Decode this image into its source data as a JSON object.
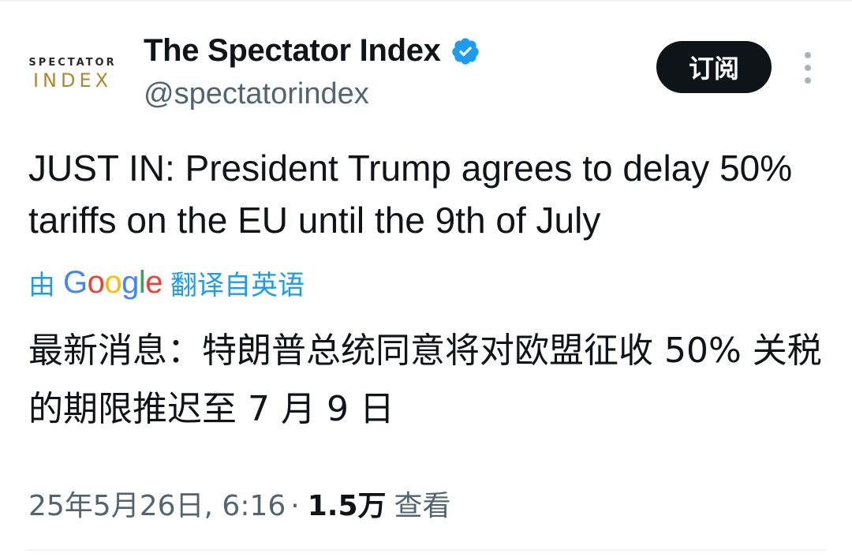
{
  "account": {
    "avatar_line1": "SPECTATOR",
    "avatar_line2": "INDEX",
    "display_name": "The Spectator Index",
    "handle": "@spectatorindex",
    "verified_color": "#1d9bf0"
  },
  "actions": {
    "subscribe_label": "订阅"
  },
  "tweet": {
    "text": "JUST IN: President Trump agrees to delay 50% tariffs on the EU until the 9th of July",
    "translate_prefix": "由",
    "google_letters": [
      "G",
      "o",
      "o",
      "g",
      "l",
      "e"
    ],
    "translate_suffix": "翻译自英语",
    "translated_text": "最新消息：特朗普总统同意将对欧盟征收 50% 关税的期限推迟至 7 月 9 日"
  },
  "meta": {
    "timestamp": "25年5月26日, 6:16",
    "separator": "·",
    "views_count": "1.5万",
    "views_label": "查看"
  },
  "colors": {
    "text": "#0f1419",
    "secondary": "#536471",
    "link": "#1d9bf0",
    "button_bg": "#0f1419"
  }
}
